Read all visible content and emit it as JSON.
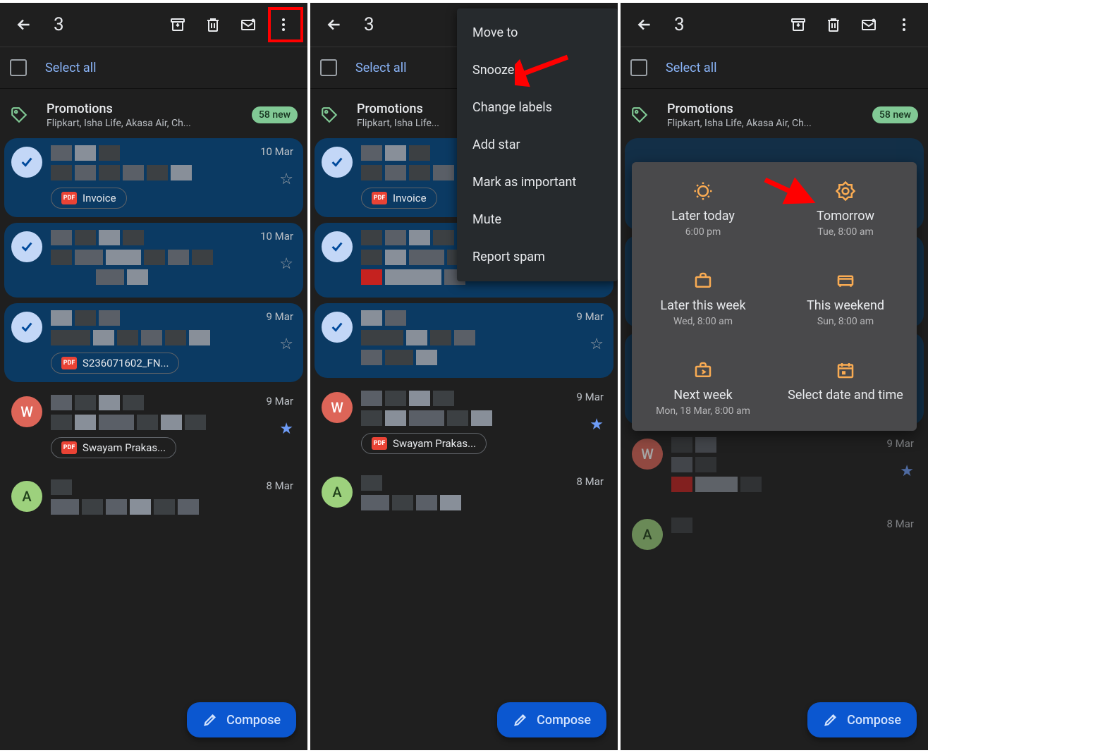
{
  "topbar": {
    "count": "3"
  },
  "select_all": "Select all",
  "promo": {
    "title": "Promotions",
    "sub": "Flipkart, Isha Life, Akasa Air, Ch...",
    "sub_short": "Flipkart, Isha Life...",
    "badge": "58 new"
  },
  "emails": [
    {
      "date": "10 Mar",
      "chip": "Invoice"
    },
    {
      "date": "10 Mar"
    },
    {
      "date": "9 Mar",
      "chip": "S236071602_FN..."
    },
    {
      "date": "9 Mar",
      "chip": "Swayam Prakas...",
      "avatar": "W"
    },
    {
      "date": "8 Mar",
      "avatar": "A"
    }
  ],
  "compose": "Compose",
  "menu": [
    "Move to",
    "Snooze",
    "Change labels",
    "Add star",
    "Mark as important",
    "Mute",
    "Report spam"
  ],
  "snooze": [
    {
      "title": "Later today",
      "sub": "6:00 pm"
    },
    {
      "title": "Tomorrow",
      "sub": "Tue, 8:00 am"
    },
    {
      "title": "Later this week",
      "sub": "Wed, 8:00 am"
    },
    {
      "title": "This weekend",
      "sub": "Sun, 8:00 am"
    },
    {
      "title": "Next week",
      "sub": "Mon, 18 Mar, 8:00 am"
    },
    {
      "title": "Select date and time",
      "sub": ""
    }
  ],
  "pdf_label": "PDF"
}
